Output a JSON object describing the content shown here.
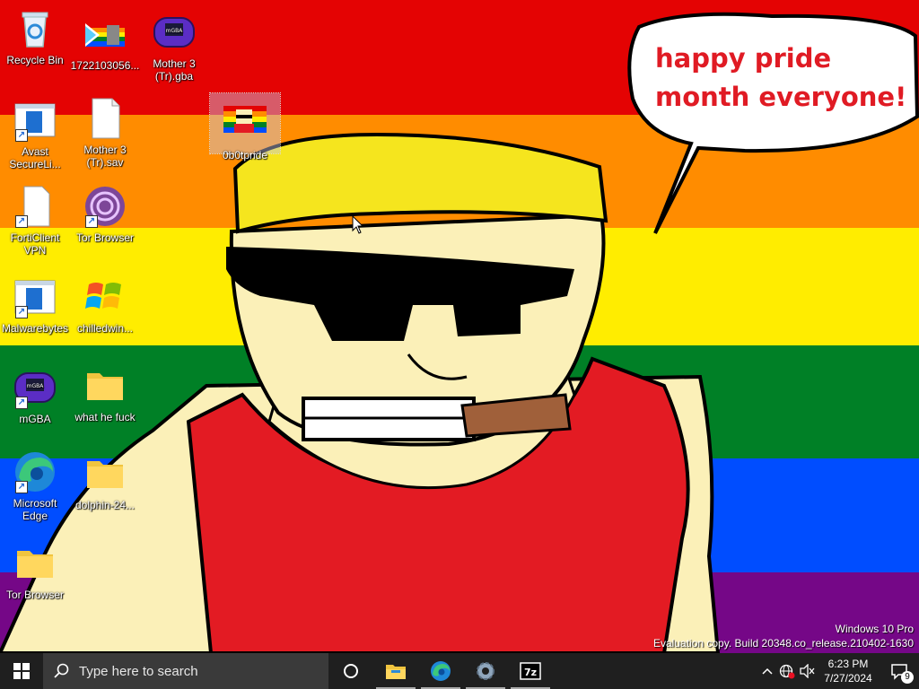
{
  "wallpaper": {
    "speech": "happy pride month everyone!"
  },
  "desktop_icons": [
    {
      "label": "Recycle Bin"
    },
    {
      "label": "1722103056..."
    },
    {
      "label": "Mother 3 (Tr).gba"
    },
    {
      "label": "Avast SecureLi..."
    },
    {
      "label": "Mother 3 (Tr).sav"
    },
    {
      "label": "0b0tpride"
    },
    {
      "label": "FortiClient VPN"
    },
    {
      "label": "Tor Browser"
    },
    {
      "label": "Malwarebytes"
    },
    {
      "label": "chilledwin..."
    },
    {
      "label": "mGBA"
    },
    {
      "label": "what he fuck"
    },
    {
      "label": "Microsoft Edge"
    },
    {
      "label": "dolphin-24..."
    },
    {
      "label": "Tor Browser"
    }
  ],
  "watermark": {
    "line1": "Windows 10 Pro",
    "line2": "Evaluation copy. Build 20348.co_release.210402-1630"
  },
  "taskbar": {
    "search_placeholder": "Type here to search",
    "apps": [
      "Cortana",
      "File Explorer",
      "Microsoft Edge",
      "Settings",
      "7-Zip"
    ],
    "time": "6:23 PM",
    "date": "7/27/2024",
    "notifications": "9"
  },
  "colors": {
    "red": "#e40303",
    "orange": "#ff8c00",
    "yellow": "#ffed00",
    "green": "#008026",
    "blue": "#004dff",
    "purple": "#750787",
    "taskbar": "#1f1f1f"
  }
}
